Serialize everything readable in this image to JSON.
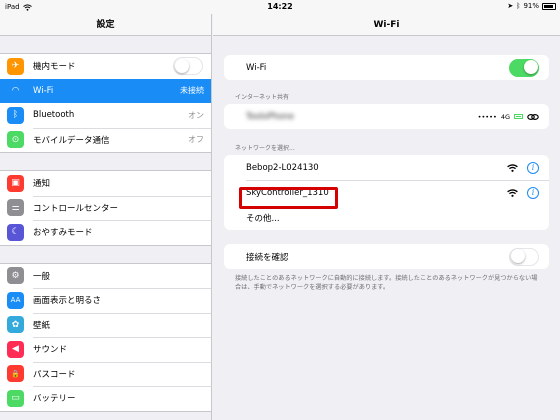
{
  "status_bar": {
    "device": "iPad",
    "time": "14:22",
    "battery": "91%",
    "battery_level": 0.91
  },
  "master": {
    "title": "設定",
    "groups": [
      [
        {
          "label": "機内モード",
          "icon": "airplane-icon",
          "color": "#ff9500",
          "glyph": "✈",
          "toggle": "off"
        },
        {
          "label": "Wi-Fi",
          "icon": "wifi-icon",
          "color": "#1a8cf5",
          "glyph": "◠",
          "value": "未接続",
          "selected": true
        },
        {
          "label": "Bluetooth",
          "icon": "bluetooth-icon",
          "color": "#1a8cf5",
          "glyph": "ᛒ",
          "value": "オン"
        },
        {
          "label": "モバイルデータ通信",
          "icon": "cellular-icon",
          "color": "#4cd964",
          "glyph": "⊙",
          "value": "オフ"
        }
      ],
      [
        {
          "label": "通知",
          "icon": "notifications-icon",
          "color": "#ff3b30",
          "glyph": "▣"
        },
        {
          "label": "コントロールセンター",
          "icon": "control-center-icon",
          "color": "#8e8e93",
          "glyph": "⚌"
        },
        {
          "label": "おやすみモード",
          "icon": "moon-icon",
          "color": "#5856d6",
          "glyph": "☾"
        }
      ],
      [
        {
          "label": "一般",
          "icon": "gear-icon",
          "color": "#8e8e93",
          "glyph": "⚙"
        },
        {
          "label": "画面表示と明るさ",
          "icon": "display-icon",
          "color": "#1a8cf5",
          "glyph": "AA"
        },
        {
          "label": "壁紙",
          "icon": "wallpaper-icon",
          "color": "#34aadc",
          "glyph": "✿"
        },
        {
          "label": "サウンド",
          "icon": "sound-icon",
          "color": "#ff2d55",
          "glyph": "◀"
        },
        {
          "label": "パスコード",
          "icon": "lock-icon",
          "color": "#ff3b30",
          "glyph": "🔒"
        },
        {
          "label": "バッテリー",
          "icon": "battery-icon",
          "color": "#4cd964",
          "glyph": "▭"
        }
      ]
    ]
  },
  "detail": {
    "title": "Wi-Fi",
    "wifi_label": "Wi-Fi",
    "wifi_toggle": "on",
    "hotspot_header": "インターネット共有",
    "hotspot_name": "TooloPhone",
    "hotspot_signal": "•••••",
    "hotspot_network": "4G",
    "networks_header": "ネットワークを選択...",
    "networks": [
      {
        "name": "Bebop2-L024130"
      },
      {
        "name": "SkyController_1310"
      }
    ],
    "other_label": "その他...",
    "ask_join_label": "接続を確認",
    "ask_join_toggle": "off",
    "ask_join_footer": "接続したことのあるネットワークに自動的に接続します。接続したことのあるネットワークが見つからない場合は、手動でネットワークを選択する必要があります。"
  }
}
